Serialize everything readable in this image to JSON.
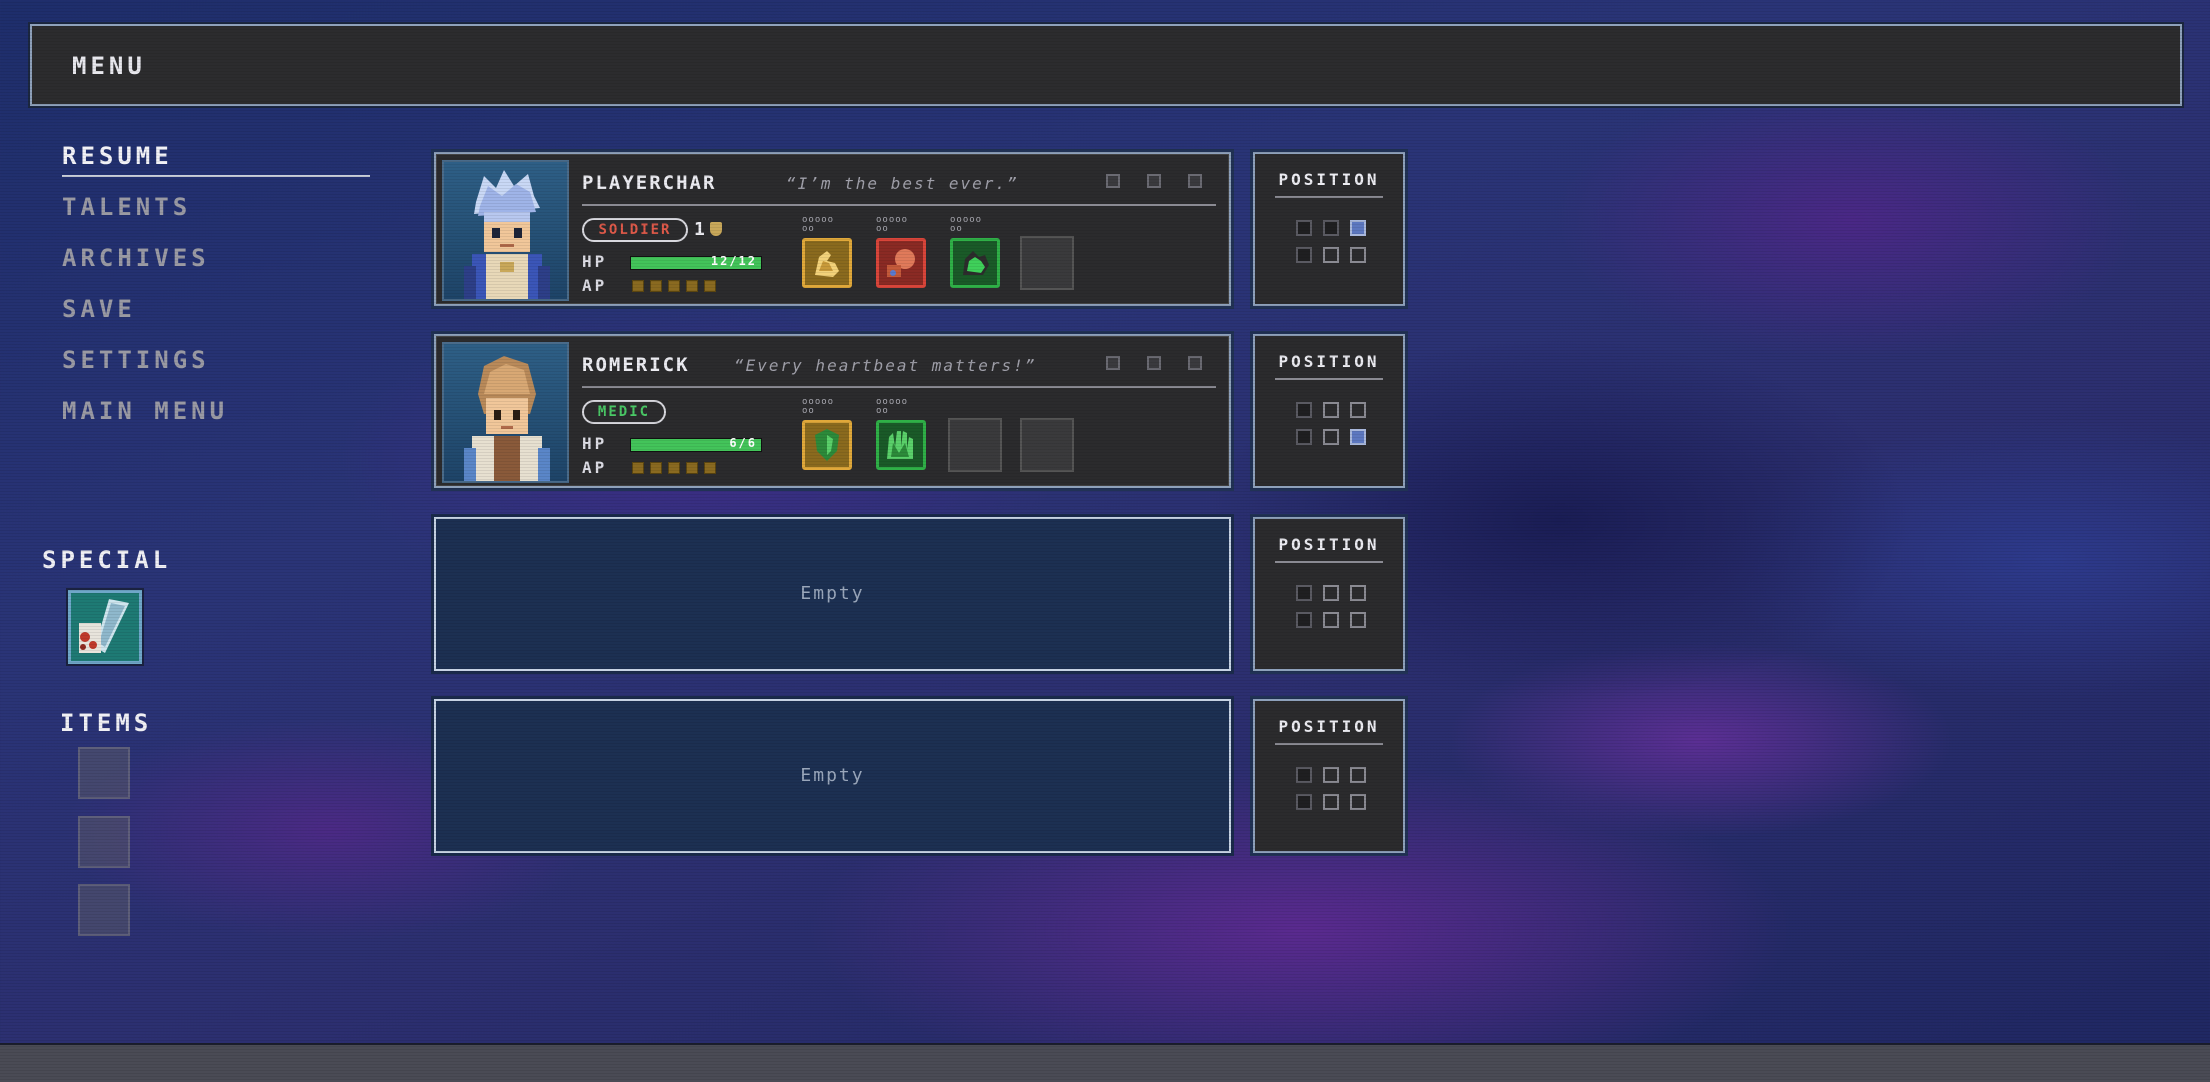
{
  "header": {
    "title": "MENU"
  },
  "nav": {
    "items": [
      {
        "label": "RESUME",
        "active": true
      },
      {
        "label": "TALENTS",
        "active": false
      },
      {
        "label": "ARCHIVES",
        "active": false
      },
      {
        "label": "SAVE",
        "active": false
      },
      {
        "label": "SETTINGS",
        "active": false
      },
      {
        "label": "MAIN MENU",
        "active": false
      }
    ]
  },
  "special": {
    "label": "SPECIAL",
    "slot_icon": "axe-scroll-icon"
  },
  "items": {
    "label": "ITEMS",
    "slot_count": 3
  },
  "party": [
    {
      "name": "PLAYERCHAR",
      "quote": "“I’m the best ever.”",
      "class_label": "SOLDIER",
      "class_color": "#e05a4a",
      "level": "1",
      "hp_label": "HP",
      "hp_text": "12/12",
      "hp_fraction": 1.0,
      "ap_label": "AP",
      "ap_pips": 5,
      "skills": [
        {
          "icon": "flex-arm-icon",
          "color": "#e0a83a",
          "dots_top": "ooooo",
          "dots_bottom": "oo"
        },
        {
          "icon": "fist-punch-icon",
          "color": "#d9453a",
          "dots_top": "ooooo",
          "dots_bottom": "oo"
        },
        {
          "icon": "muscle-arm-icon",
          "color": "#2fb047",
          "dots_top": "ooooo",
          "dots_bottom": "oo"
        }
      ],
      "empty_skill_slots": 1,
      "position_label": "POSITION",
      "position_grid": [
        [
          0,
          0,
          1
        ],
        [
          0,
          0,
          0
        ]
      ]
    },
    {
      "name": "ROMERICK",
      "quote": "“Every heartbeat matters!”",
      "class_label": "MEDIC",
      "class_color": "#4ac866",
      "level": "",
      "hp_label": "HP",
      "hp_text": "6/6",
      "hp_fraction": 1.0,
      "ap_label": "AP",
      "ap_pips": 5,
      "skills": [
        {
          "icon": "green-shield-icon",
          "color": "#e0a83a",
          "dots_top": "ooooo",
          "dots_bottom": "oo"
        },
        {
          "icon": "healing-hands-icon",
          "color": "#2fb047",
          "dots_top": "ooooo",
          "dots_bottom": "oo"
        }
      ],
      "empty_skill_slots": 2,
      "position_label": "POSITION",
      "position_grid": [
        [
          0,
          0,
          0
        ],
        [
          0,
          0,
          1
        ]
      ]
    }
  ],
  "empty_slots": [
    {
      "label": "Empty",
      "position_label": "POSITION"
    },
    {
      "label": "Empty",
      "position_label": "POSITION"
    }
  ]
}
